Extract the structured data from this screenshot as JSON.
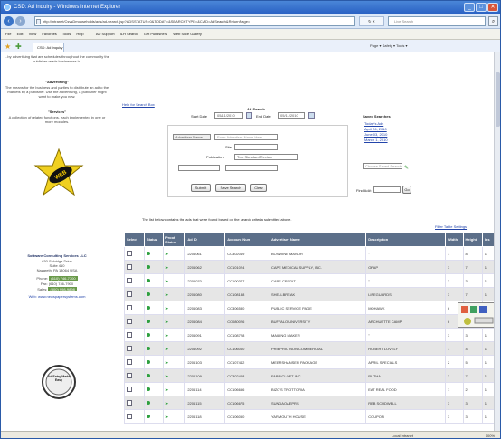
{
  "window": {
    "title": "CSD: Ad Inquiry - Windows Internet Explorer"
  },
  "nav": {
    "address": "http://intranet/CsvsDmouseholds/ads/ad-search.jsp?ADSSTATUS=0&TODAY=&SEARCHTYPE=&CMD=AdSearch&ReturnPage=",
    "refresh_label": "↻ ✕",
    "search_placeholder": "Live Search"
  },
  "menu": [
    "File",
    "Edit",
    "View",
    "Favorites",
    "Tools",
    "Help"
  ],
  "favorites": {
    "items": [
      "AD Support",
      "ILH Search",
      "Get Publishers",
      "Web Slice Gallery"
    ]
  },
  "tab": {
    "label": "CSD: Ad Inquiry"
  },
  "toolbar_right": "Page ▾  Safety ▾  Tools ▾",
  "left": {
    "intro1": "...by advertising that are schedules throughout the community the publisher reads businesses in.",
    "adv_title": "\"Advertising\"",
    "adv_text": "The means for the business and parties to distribute an ad to the markets by a publisher. Use the advertising, a publisher might want to make you new.",
    "srv_title": "\"Services\"",
    "srv_text": "A collection of related functions, each implemented in one or more modules.",
    "logo_text": "WEB",
    "company": "Software Consulting Services LLC",
    "addr1": "630 Selvidge Drive",
    "addr2": "Suite 410",
    "addr3": "Nazareth, PA 18064 USA",
    "phone_label": "Phone:",
    "phone": "(610) 746-7700",
    "fax": "Fax: (610) 746-7900",
    "sales_label": "Sales:",
    "sales": "(800) 998-9898",
    "web": "Web: www.newspapersystems.com",
    "badge_text": "Ad Entry Made Easy"
  },
  "main": {
    "help_link": "Help for Search Box",
    "title": "Ad Search",
    "start_label": "Start Date",
    "start_value": "05/11/2010",
    "end_label": "End Date",
    "end_value": "05/11/2010",
    "adv_select": "Advertiser Name",
    "adv_placeholder": "Enter Advertiser Name Here",
    "site_label": "Site",
    "pub_label": "Publication",
    "pub_value": "Two Standard Review",
    "submit": "Submit",
    "save": "Save Search",
    "clear": "Clear",
    "saved_title": "Saved Searches",
    "saved_items": [
      "Today's Ads",
      "April 26, 2010",
      "June 03, 2010",
      "March 1, 2010"
    ],
    "saved_select": "Choose Saved Search",
    "find_label": "Find Ad#:",
    "go": "Go",
    "info": "The list below contains the ads that were found based on the search criteria submitted above.",
    "filter_link": "Filter  Table Settings"
  },
  "table": {
    "headers": [
      "Select",
      "Status",
      "Proof Status",
      "Ad ID",
      "Account Num",
      "Advertiser Name",
      "Description",
      "Width",
      "Height",
      "Ins"
    ],
    "rows": [
      [
        "2206061",
        "CC302049",
        "BOSWINE MANOR",
        "\"",
        "1",
        "8",
        "1"
      ],
      [
        "2206062",
        "CC101024",
        "CAPE MEDICAL SUPPLY, INC.",
        "OPAP",
        "3",
        "7",
        "1"
      ],
      [
        "2206070",
        "CC100377",
        "CAPE CREDIT",
        "\"",
        "3",
        "3",
        "1"
      ],
      [
        "2206080",
        "CC108138",
        "SHELLBREAK",
        "LIFEGUARDS",
        "3",
        "7",
        "1"
      ],
      [
        "2206083",
        "CC306530",
        "PUBLIC SERVICE PAGE",
        "MOHAWK",
        "6",
        "21.25",
        "1"
      ],
      [
        "2206084",
        "CC080026",
        "BUFFALO UNIVERSITY",
        "ARCHUETTE CAMP",
        "6",
        "7",
        "1"
      ],
      [
        "2206091",
        "CC108728",
        "MAILING MAKER",
        "\"",
        "3",
        "3",
        "1"
      ],
      [
        "2206092",
        "CC106060",
        "PRIEPRIC NON COMMERCIAL",
        "ROBERT LOVELY",
        "1",
        "4",
        "1"
      ],
      [
        "2206103",
        "CC107442",
        "MEERSHANSER PACKAGE",
        "APRIL SPECIALS",
        "2",
        "5",
        "1"
      ],
      [
        "2206109",
        "CC302428",
        "FABRICLOFT INC",
        "RUTHA",
        "3",
        "7",
        "1"
      ],
      [
        "2206114",
        "CC106656",
        "BIZO'S TROTTORIA",
        "EAT REAL FOOD",
        "1",
        "2",
        "1"
      ],
      [
        "2206115",
        "CC106675",
        "SUNDAOAEPRS",
        "REB SCUDWELL",
        "3",
        "3",
        "1"
      ],
      [
        "2206118",
        "CC106050",
        "YARMOUTH HOUSE",
        "COUPON",
        "3",
        "3",
        "1"
      ]
    ]
  },
  "status": {
    "zone": "Local intranet",
    "zoom": "100%"
  }
}
